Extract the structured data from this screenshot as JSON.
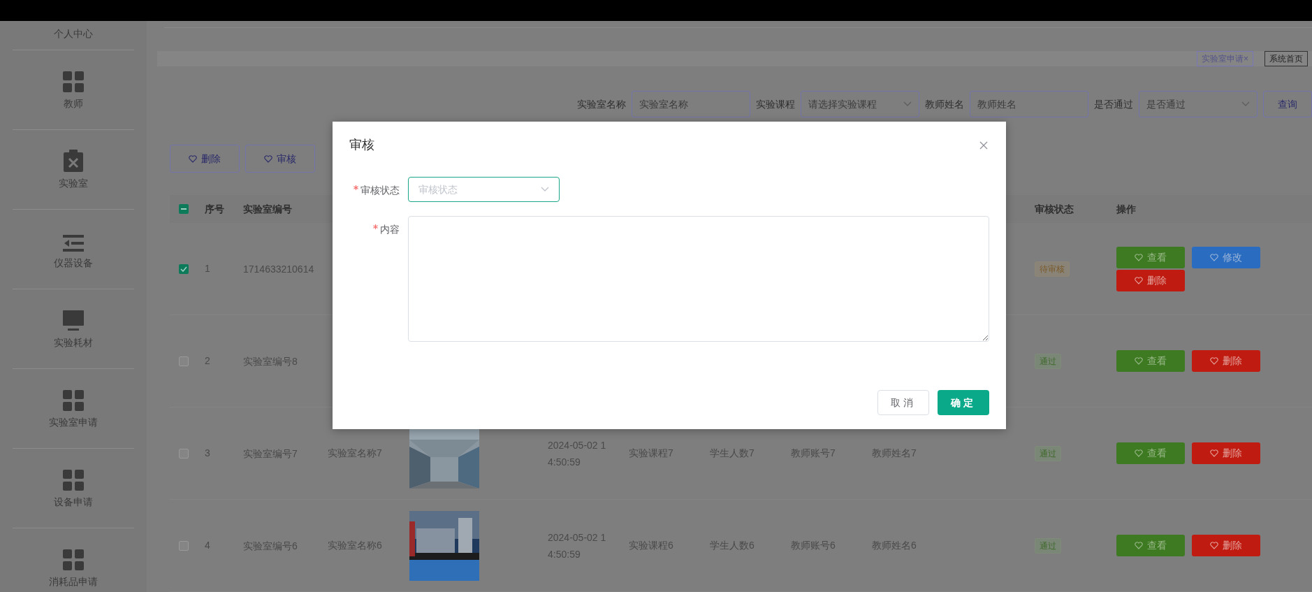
{
  "sidebar": {
    "items": [
      {
        "label": "个人中心",
        "selected": false
      },
      {
        "label": "教师",
        "selected": false
      },
      {
        "label": "实验室",
        "selected": false
      },
      {
        "label": "仪器设备",
        "selected": false
      },
      {
        "label": "实验耗材",
        "selected": false
      },
      {
        "label": "实验室申请",
        "selected": false
      },
      {
        "label": "设备申请",
        "selected": false
      },
      {
        "label": "消耗品申请",
        "selected": false
      }
    ]
  },
  "tags": [
    {
      "label": "实验室申请×",
      "selected": true
    },
    {
      "label": "系统首页",
      "selected": false
    }
  ],
  "search": {
    "fields": [
      {
        "label": "实验室名称",
        "placeholder": "实验室名称",
        "kind": "input"
      },
      {
        "label": "实验课程",
        "placeholder": "请选择实验课程",
        "kind": "select"
      },
      {
        "label": "教师姓名",
        "placeholder": "教师姓名",
        "kind": "input"
      },
      {
        "label": "是否通过",
        "placeholder": "是否通过",
        "kind": "select"
      }
    ],
    "button": "查询"
  },
  "toolbar": [
    "删除",
    "审核"
  ],
  "table": {
    "header_checkbox": {
      "indeterminate": true
    },
    "columns": [
      "序号",
      "实验室编号",
      "审核状态",
      "操作"
    ],
    "rows": [
      {
        "checked": true,
        "index": "1",
        "code": "1714633210614",
        "status": {
          "label": "待审核",
          "kind": "pending"
        },
        "actions": [
          {
            "label": "查看",
            "kind": "view"
          },
          {
            "label": "修改",
            "kind": "edit"
          },
          {
            "label": "删除",
            "kind": "delete"
          }
        ]
      },
      {
        "checked": false,
        "index": "2",
        "code": "实验室编号8",
        "status": {
          "label": "通过",
          "kind": "passed"
        },
        "actions": [
          {
            "label": "查看",
            "kind": "view"
          },
          {
            "label": "删除",
            "kind": "delete"
          }
        ]
      },
      {
        "checked": false,
        "index": "3",
        "code": "实验室编号7",
        "name": "实验室名称7",
        "image": {
          "kind": "picture"
        },
        "time": "2024-05-02 14:50:59",
        "course": "实验课程7",
        "students": "学生人数7",
        "teacher_account": "教师账号7",
        "teacher_name": "教师姓名7",
        "status": {
          "label": "通过",
          "kind": "passed"
        },
        "actions": [
          {
            "label": "查看",
            "kind": "view"
          },
          {
            "label": "删除",
            "kind": "delete"
          }
        ]
      },
      {
        "checked": false,
        "index": "4",
        "code": "实验室编号6",
        "name": "实验室名称6",
        "image": {
          "kind": "picture"
        },
        "time": "2024-05-02 14:50:59",
        "course": "实验课程6",
        "students": "学生人数6",
        "teacher_account": "教师账号6",
        "teacher_name": "教师姓名6",
        "status": {
          "label": "通过",
          "kind": "passed"
        },
        "actions": [
          {
            "label": "查看",
            "kind": "view"
          },
          {
            "label": "删除",
            "kind": "delete"
          }
        ]
      }
    ]
  },
  "dialog": {
    "title": "审核",
    "fields": [
      {
        "label": "审核状态",
        "required": true,
        "kind": "select",
        "placeholder": "审核状态"
      },
      {
        "label": "内容",
        "required": true,
        "kind": "textarea"
      }
    ],
    "buttons": [
      {
        "label": "取消",
        "kind": "cancel"
      },
      {
        "label": "确定",
        "kind": "primary"
      }
    ]
  }
}
